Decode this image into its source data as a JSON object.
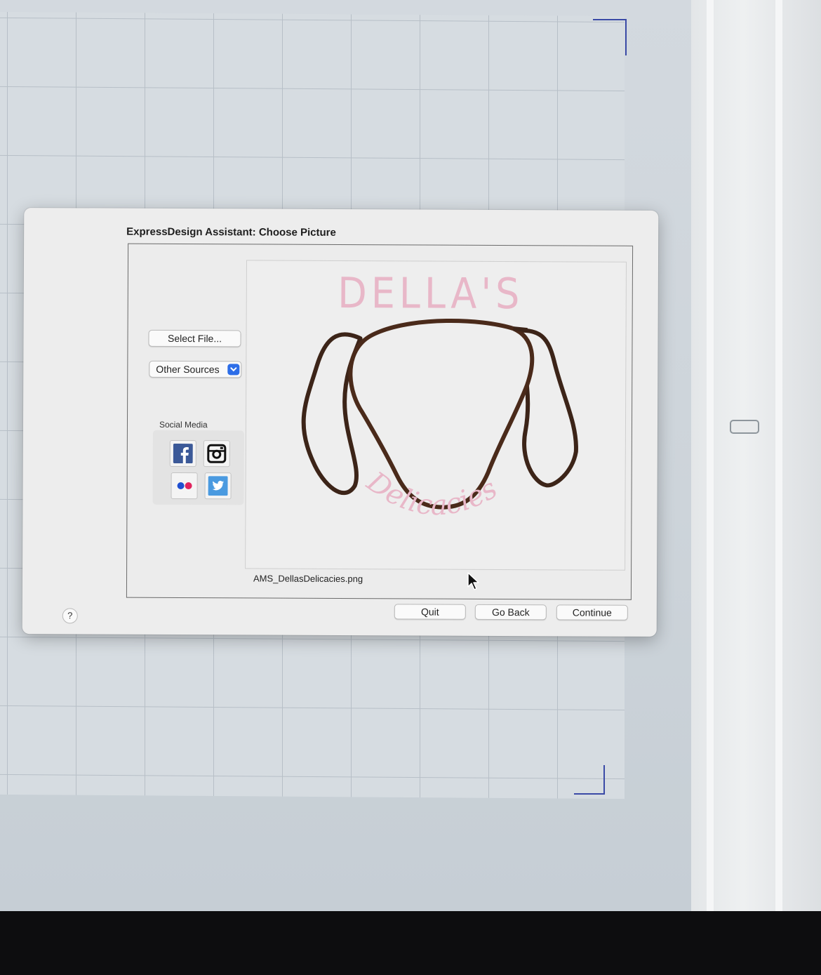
{
  "dialog": {
    "title": "ExpressDesign Assistant: Choose Picture",
    "select_file_label": "Select File...",
    "other_sources_label": "Other Sources",
    "social_media_label": "Social Media",
    "social_buttons": [
      "facebook-icon",
      "instagram-icon",
      "flickr-icon",
      "twitter-icon"
    ],
    "preview": {
      "logo_text_top": "DELLA'S",
      "logo_text_script": "Delicacies",
      "file_name": "AMS_DellasDelicacies.png"
    },
    "buttons": {
      "quit": "Quit",
      "go_back": "Go Back",
      "continue": "Continue",
      "help": "?"
    }
  },
  "colors": {
    "accent": "#2d6ee8",
    "logo_pink": "#e8b7c8",
    "logo_brown": "#4a2a1a",
    "facebook": "#3b5998",
    "twitter": "#4a9ae0",
    "flickr_blue": "#1f4fd1",
    "flickr_pink": "#e0245e"
  }
}
